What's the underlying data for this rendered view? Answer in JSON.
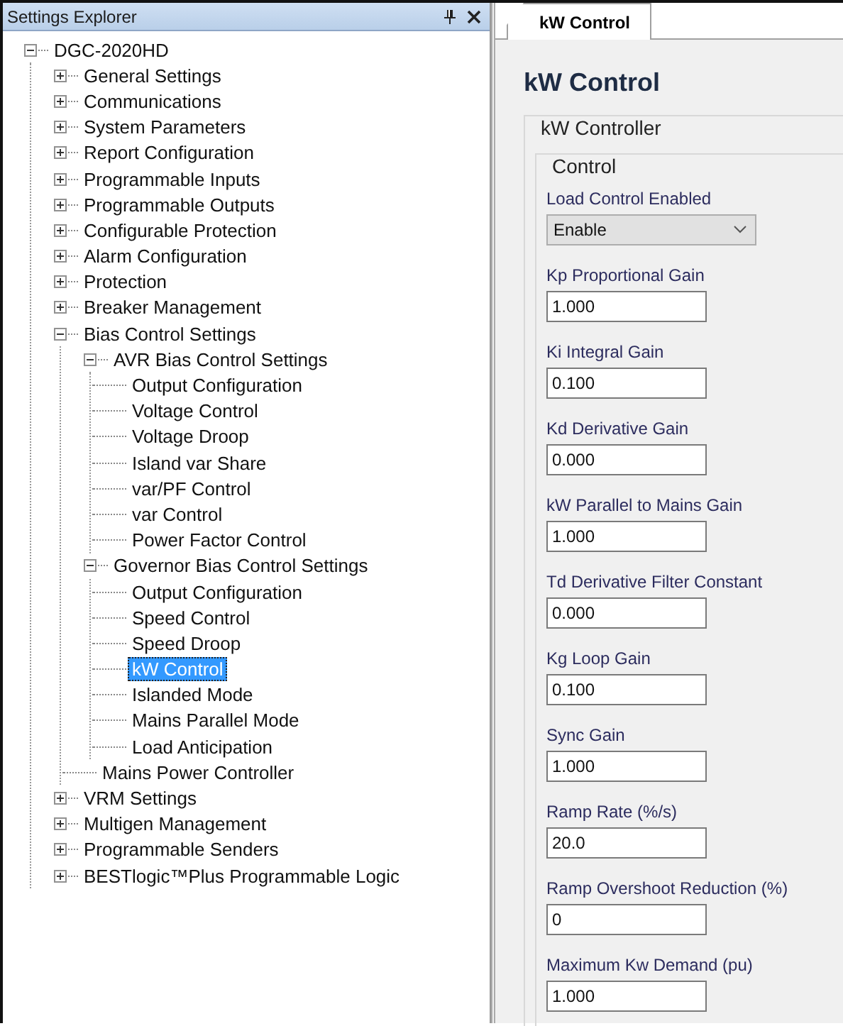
{
  "explorer": {
    "title": "Settings Explorer"
  },
  "tree": [
    {
      "label": "DGC-2020HD",
      "expanded": true,
      "selected": false,
      "children": [
        {
          "label": "General Settings",
          "expanded": false,
          "selected": false
        },
        {
          "label": "Communications",
          "expanded": false,
          "selected": false
        },
        {
          "label": "System Parameters",
          "expanded": false,
          "selected": false
        },
        {
          "label": "Report Configuration",
          "expanded": false,
          "selected": false
        },
        {
          "label": "Programmable Inputs",
          "expanded": false,
          "selected": false
        },
        {
          "label": "Programmable Outputs",
          "expanded": false,
          "selected": false
        },
        {
          "label": "Configurable Protection",
          "expanded": false,
          "selected": false
        },
        {
          "label": "Alarm Configuration",
          "expanded": false,
          "selected": false
        },
        {
          "label": "Protection",
          "expanded": false,
          "selected": false
        },
        {
          "label": "Breaker Management",
          "expanded": false,
          "selected": false
        },
        {
          "label": "Bias Control Settings",
          "expanded": true,
          "selected": false,
          "children": [
            {
              "label": "AVR Bias Control Settings",
              "expanded": true,
              "selected": false,
              "children": [
                {
                  "label": "Output Configuration",
                  "selected": false
                },
                {
                  "label": "Voltage Control",
                  "selected": false
                },
                {
                  "label": "Voltage Droop",
                  "selected": false
                },
                {
                  "label": "Island var Share",
                  "selected": false
                },
                {
                  "label": "var/PF Control",
                  "selected": false
                },
                {
                  "label": "var Control",
                  "selected": false
                },
                {
                  "label": "Power Factor Control",
                  "selected": false
                }
              ]
            },
            {
              "label": "Governor Bias Control Settings",
              "expanded": true,
              "selected": false,
              "children": [
                {
                  "label": "Output Configuration",
                  "selected": false
                },
                {
                  "label": "Speed Control",
                  "selected": false
                },
                {
                  "label": "Speed Droop",
                  "selected": false
                },
                {
                  "label": "kW Control",
                  "selected": true
                },
                {
                  "label": "Islanded Mode",
                  "selected": false
                },
                {
                  "label": "Mains Parallel Mode",
                  "selected": false
                },
                {
                  "label": "Load Anticipation",
                  "selected": false
                }
              ]
            },
            {
              "label": "Mains Power Controller",
              "selected": false
            }
          ]
        },
        {
          "label": "VRM Settings",
          "expanded": false,
          "selected": false
        },
        {
          "label": "Multigen Management",
          "expanded": false,
          "selected": false
        },
        {
          "label": "Programmable Senders",
          "expanded": false,
          "selected": false
        },
        {
          "label": "BESTlogic™Plus Programmable Logic",
          "expanded": false,
          "selected": false
        }
      ]
    }
  ],
  "tabs": [
    {
      "label": "kW Control",
      "selected": true
    }
  ],
  "page": {
    "title": "kW Control",
    "group": "kW Controller",
    "subgroup": "Control"
  },
  "fields": [
    {
      "kind": "dropdown",
      "label": "Load Control Enabled",
      "value": "Enable"
    },
    {
      "kind": "text",
      "label": "Kp Proportional Gain",
      "value": "1.000"
    },
    {
      "kind": "text",
      "label": "Ki Integral Gain",
      "value": "0.100"
    },
    {
      "kind": "text",
      "label": "Kd Derivative Gain",
      "value": "0.000"
    },
    {
      "kind": "text",
      "label": "kW Parallel to Mains Gain",
      "value": "1.000"
    },
    {
      "kind": "text",
      "label": "Td Derivative Filter Constant",
      "value": "0.000"
    },
    {
      "kind": "text",
      "label": "Kg Loop Gain",
      "value": "0.100"
    },
    {
      "kind": "text",
      "label": "Sync Gain",
      "value": "1.000"
    },
    {
      "kind": "text",
      "label": "Ramp Rate (%/s)",
      "value": "20.0"
    },
    {
      "kind": "text",
      "label": "Ramp Overshoot Reduction (%)",
      "value": "0"
    },
    {
      "kind": "text",
      "label": "Maximum Kw Demand (pu)",
      "value": "1.000"
    }
  ]
}
